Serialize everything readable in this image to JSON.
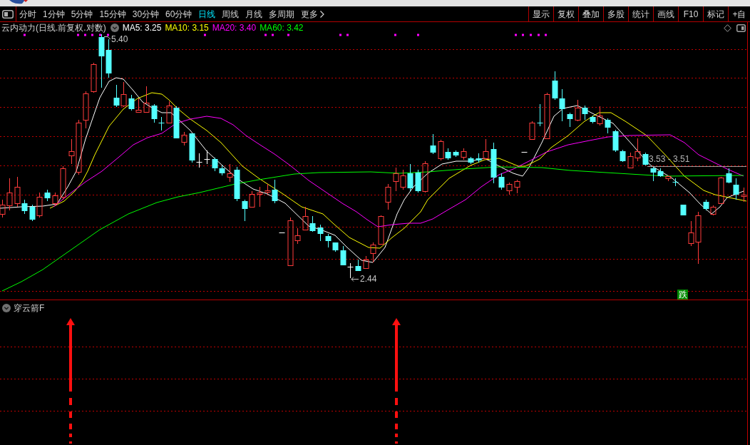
{
  "toolbar": {
    "periods": [
      {
        "label": "分时",
        "selected": false,
        "kind": "period"
      },
      {
        "label": "1分钟",
        "selected": false,
        "kind": "period"
      },
      {
        "label": "5分钟",
        "selected": false,
        "kind": "period"
      },
      {
        "label": "15分钟",
        "selected": false,
        "kind": "period"
      },
      {
        "label": "30分钟",
        "selected": false,
        "kind": "period"
      },
      {
        "label": "60分钟",
        "selected": false,
        "kind": "period"
      },
      {
        "label": "日线",
        "selected": true,
        "kind": "period"
      },
      {
        "label": "周线",
        "selected": false,
        "kind": "period"
      },
      {
        "label": "月线",
        "selected": false,
        "kind": "period"
      },
      {
        "label": "多周期",
        "selected": false,
        "kind": "period"
      },
      {
        "label": "更多",
        "selected": false,
        "kind": "menu"
      }
    ],
    "actions": [
      "显示",
      "复权",
      "叠加",
      "多股",
      "统计",
      "画线",
      "F10",
      "标记",
      "+自"
    ]
  },
  "main_chart": {
    "title": "云内动力(日线.前复权.对数)",
    "moving_averages": [
      {
        "label": "MA5: 3.25",
        "color": "#ffffff"
      },
      {
        "label": "MA10: 3.15",
        "color": "#ffff00"
      },
      {
        "label": "MA20: 3.40",
        "color": "#ff00ff"
      },
      {
        "label": "MA60: 3.42",
        "color": "#00ff00"
      }
    ],
    "high_label": "5.40",
    "low_label": "2.44",
    "range_label": "3.53 - 3.51",
    "signal_badge": "跌"
  },
  "sub_chart": {
    "title": "穿云箭F"
  }
}
